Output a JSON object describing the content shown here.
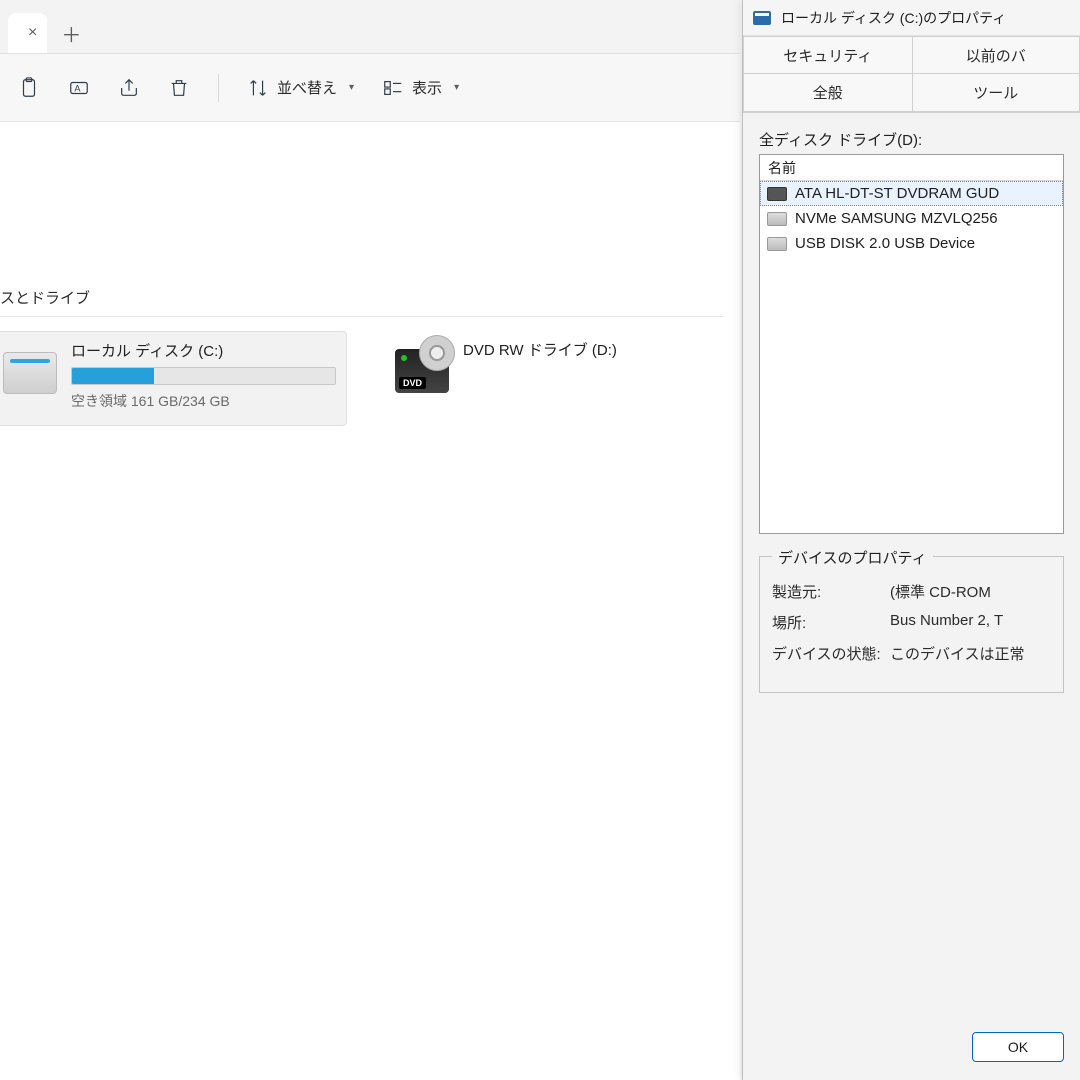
{
  "explorer": {
    "toolbar": {
      "sort_label": "並べ替え",
      "view_label": "表示"
    },
    "section": {
      "devices_and_drives_suffix": "スとドライブ"
    },
    "drives": [
      {
        "name": "ローカル ディスク (C:)",
        "free_text": "空き領域 161 GB/234 GB",
        "fill_percent": 31,
        "selected": true,
        "kind": "hdd"
      },
      {
        "name": "DVD RW ドライブ (D:)",
        "kind": "dvd"
      }
    ]
  },
  "dialog": {
    "title": "ローカル ディスク (C:)のプロパティ",
    "tabs": {
      "security": "セキュリティ",
      "previous": "以前のバ",
      "general": "全般",
      "tools": "ツール"
    },
    "list_label": "全ディスク ドライブ(D):",
    "list_header": "名前",
    "drives": [
      {
        "name": "ATA HL-DT-ST DVDRAM GUD",
        "selected": true,
        "icon": "dark"
      },
      {
        "name": "NVMe SAMSUNG MZVLQ256",
        "icon": "light"
      },
      {
        "name": "USB DISK 2.0 USB Device",
        "icon": "light"
      }
    ],
    "group_title": "デバイスのプロパティ",
    "props": {
      "manufacturer_key": "製造元:",
      "manufacturer_val": "(標準 CD-ROM",
      "location_key": "場所:",
      "location_val": "Bus Number 2, T",
      "status_key": "デバイスの状態:",
      "status_val": "このデバイスは正常"
    },
    "ok_label": "OK"
  }
}
